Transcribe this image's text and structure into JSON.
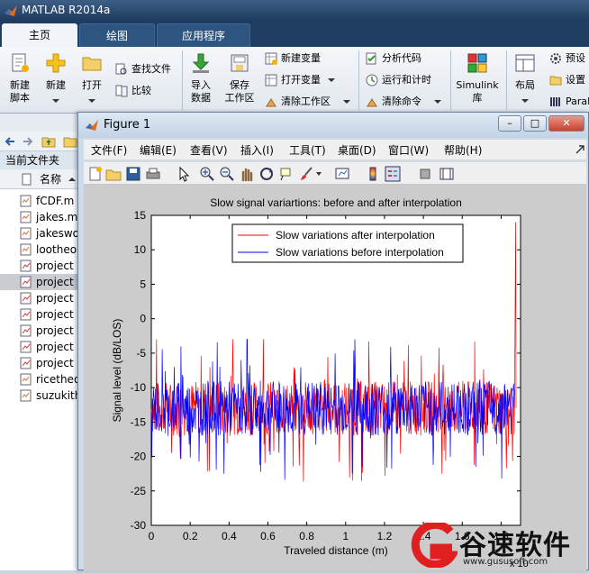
{
  "app": {
    "title": "MATLAB R2014a"
  },
  "ribbon_tabs": [
    {
      "label": "主页",
      "active": true
    },
    {
      "label": "绘图",
      "active": false
    },
    {
      "label": "应用程序",
      "active": false
    }
  ],
  "ribbon": {
    "new_script": "新建\n脚本",
    "new": "新建",
    "open": "打开",
    "find_files": "查找文件",
    "compare": "比较",
    "import_data": "导入\n数据",
    "save_workspace": "保存\n工作区",
    "new_variable": "新建变量",
    "open_variable": "打开变量",
    "clear_workspace": "清除工作区",
    "analyze_code": "分析代码",
    "run_and_time": "运行和计时",
    "clear_commands": "清除命令",
    "simulink": "Simulink\n库",
    "layout": "布局",
    "preferences": "预设",
    "set_path": "设置",
    "parallel": "Paral"
  },
  "file_panel": {
    "current_folder": "当前文件夹",
    "name_column": "名称",
    "files": [
      {
        "name": "fCDF.m",
        "type": "m"
      },
      {
        "name": "jakes.m",
        "type": "m"
      },
      {
        "name": "jakeswo",
        "type": "m"
      },
      {
        "name": "lootheo",
        "type": "m"
      },
      {
        "name": "project",
        "type": "fig"
      },
      {
        "name": "project",
        "type": "fig",
        "selected": true
      },
      {
        "name": "project",
        "type": "fig"
      },
      {
        "name": "project",
        "type": "fig"
      },
      {
        "name": "project",
        "type": "fig"
      },
      {
        "name": "project",
        "type": "fig"
      },
      {
        "name": "project",
        "type": "fig"
      },
      {
        "name": "ricetheo",
        "type": "m"
      },
      {
        "name": "suzukith",
        "type": "m"
      }
    ]
  },
  "figure": {
    "title": "Figure 1",
    "menu": [
      "文件(F)",
      "编辑(E)",
      "查看(V)",
      "插入(I)",
      "工具(T)",
      "桌面(D)",
      "窗口(W)",
      "帮助(H)"
    ]
  },
  "chart_data": {
    "type": "line",
    "title": "Slow signal variartions: before and after interpolation",
    "xlabel": "Traveled distance (m)",
    "ylabel": "Signal level (dB/LOS)",
    "xlim": [
      0,
      1.9
    ],
    "ylim": [
      -30,
      15
    ],
    "xticks": [
      0,
      0.2,
      0.4,
      0.6,
      0.8,
      1,
      1.2,
      1.4,
      1.6,
      1.8
    ],
    "yticks": [
      15,
      10,
      5,
      0,
      -5,
      -10,
      -15,
      -20,
      -25,
      -30
    ],
    "x_exponent_label": "x 10",
    "legend_position": "top-center",
    "series": [
      {
        "name": "Slow variations after interpolation",
        "color": "#ff0000",
        "mean": -13,
        "spread": 4,
        "range": [
          -25,
          -3
        ],
        "end_spike": 14
      },
      {
        "name": "Slow variations before interpolation",
        "color": "#0000ff",
        "mean": -13,
        "spread": 4,
        "range": [
          -25,
          -3
        ]
      }
    ]
  },
  "watermark": {
    "text": "谷速软件",
    "url": "www.gususoft.com"
  }
}
